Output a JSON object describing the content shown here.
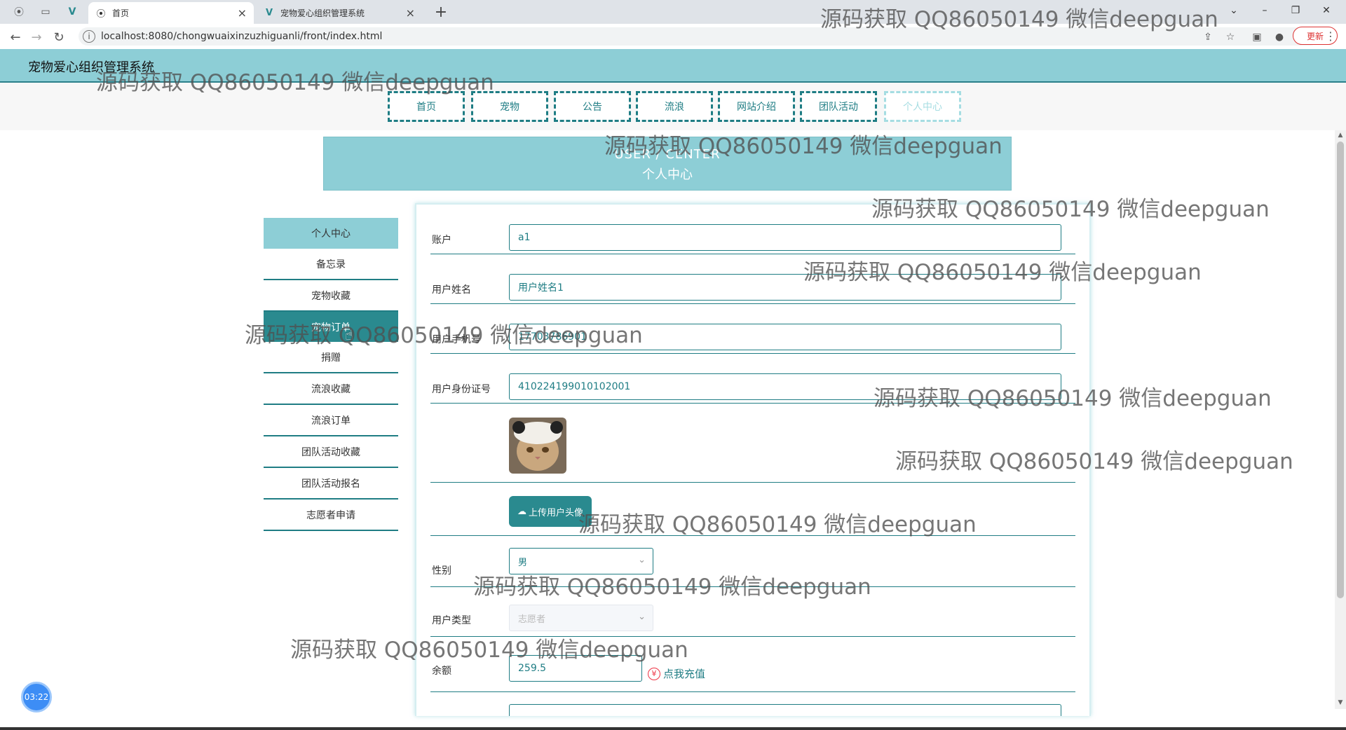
{
  "browser": {
    "tabs": [
      {
        "title": "首页",
        "close": "×"
      },
      {
        "title": "宠物爱心组织管理系统",
        "close": "×"
      }
    ],
    "new_tab": "+",
    "url": "localhost:8080/chongwuaixinzuzhiguanli/front/index.html",
    "update_label": "更新",
    "window_controls": [
      "⌄",
      "–",
      "❐",
      "✕"
    ]
  },
  "site": {
    "title": "宠物爱心组织管理系统",
    "nav": [
      "首页",
      "宠物",
      "公告",
      "流浪",
      "网站介绍",
      "团队活动",
      "个人中心"
    ],
    "active_nav": "个人中心"
  },
  "banner": {
    "en": "USER / CENTER",
    "zh": "个人中心"
  },
  "sidebar": {
    "items": [
      "个人中心",
      "备忘录",
      "宠物收藏",
      "宠物订单",
      "捐赠",
      "流浪收藏",
      "流浪订单",
      "团队活动收藏",
      "团队活动报名",
      "志愿者申请"
    ]
  },
  "form": {
    "account_label": "账户",
    "account_value": "a1",
    "name_label": "用户姓名",
    "name_value": "用户姓名1",
    "phone_label": "用户手机号",
    "phone_value": "17703786901",
    "id_label": "用户身份证号",
    "id_value": "410224199010102001",
    "upload_label": "上传用户头像",
    "gender_label": "性别",
    "gender_value": "男",
    "type_label": "用户类型",
    "type_value": "志愿者",
    "balance_label": "余额",
    "balance_value": "259.5",
    "recharge_label": "点我充值"
  },
  "timer": "03:22",
  "watermark": "源码获取 QQ86050149 微信deepguan"
}
